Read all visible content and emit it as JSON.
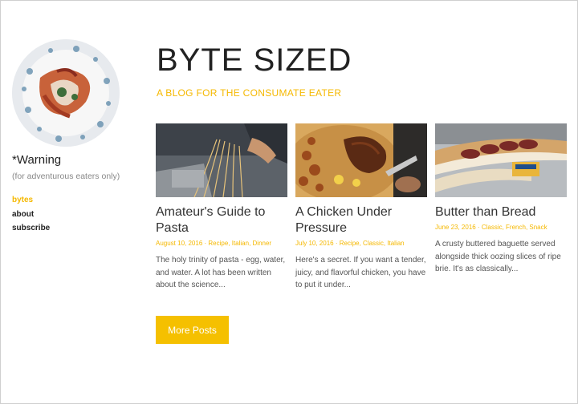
{
  "sidebar": {
    "site_name": "*Warning",
    "tagline": "(for adventurous eaters only)",
    "nav": [
      {
        "label": "bytes",
        "active": true
      },
      {
        "label": "about",
        "active": false
      },
      {
        "label": "subscribe",
        "active": false
      }
    ]
  },
  "header": {
    "title": "BYTE SIZED",
    "subtitle": "A BLOG FOR THE CONSUMATE EATER"
  },
  "posts": [
    {
      "title": "Amateur's Guide to Pasta",
      "meta": "August 10, 2016 · Recipe, Italian, Dinner",
      "excerpt": "The holy trinity of pasta - egg, water, and water. A lot has been written about the science..."
    },
    {
      "title": "A Chicken Under Pressure",
      "meta": "July 10, 2016 · Recipe, Classic, Italian",
      "excerpt": "Here's a secret. If you want a tender, juicy, and flavorful chicken, you have to put it under..."
    },
    {
      "title": "Butter than Bread",
      "meta": "June 23, 2016 · Classic, French, Snack",
      "excerpt": "A crusty buttered baguette served alongside thick oozing slices of ripe brie. It's as classically..."
    }
  ],
  "more_button": "More Posts",
  "colors": {
    "accent": "#f5b800",
    "button": "#f5c000"
  }
}
